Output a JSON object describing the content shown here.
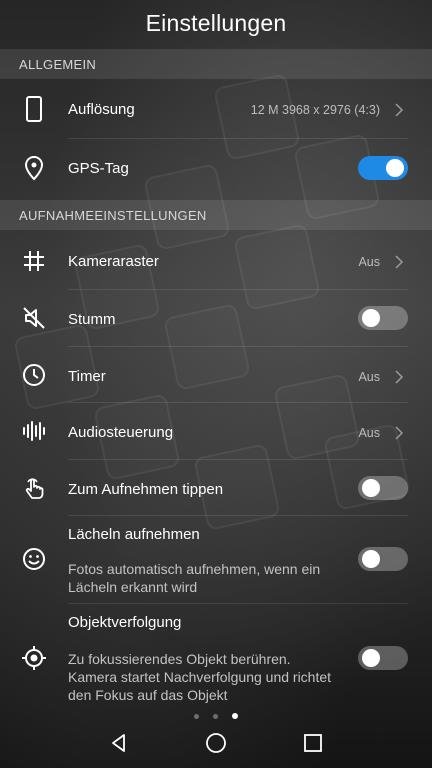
{
  "header": {
    "title": "Einstellungen"
  },
  "sections": {
    "general": "ALLGEMEIN",
    "capture": "AUFNAHMEEINSTELLUNGEN"
  },
  "settings": {
    "resolution": {
      "label": "Auflösung",
      "value": "12 M 3968 x 2976 (4:3)",
      "icon": "phone-outline-icon"
    },
    "gps_tag": {
      "label": "GPS-Tag",
      "enabled": true,
      "icon": "location-pin-icon"
    },
    "grid": {
      "label": "Kameraraster",
      "value": "Aus",
      "icon": "grid-hash-icon"
    },
    "mute": {
      "label": "Stumm",
      "enabled": false,
      "icon": "speaker-muted-icon"
    },
    "timer": {
      "label": "Timer",
      "value": "Aus",
      "icon": "clock-icon"
    },
    "audio_control": {
      "label": "Audiosteuerung",
      "value": "Aus",
      "icon": "sound-wave-icon"
    },
    "tap_to_capture": {
      "label": "Zum Aufnehmen tippen",
      "enabled": false,
      "icon": "tap-finger-icon"
    },
    "smile_capture": {
      "label": "Lächeln aufnehmen",
      "description": "Fotos automatisch aufnehmen, wenn ein Lächeln erkannt wird",
      "enabled": false,
      "icon": "smiley-icon"
    },
    "object_tracking": {
      "label": "Objektverfolgung",
      "description": "Zu fokussierendes Objekt berühren. Kamera startet Nachverfolgung und richtet den Fokus auf das Objekt",
      "enabled": false,
      "icon": "target-crosshair-icon"
    }
  },
  "pager": {
    "pages": 3,
    "active": 3
  },
  "navbar": {
    "items": [
      "back-triangle-icon",
      "home-circle-icon",
      "recents-square-icon"
    ]
  },
  "colors": {
    "accent": "#1f8ae6"
  }
}
